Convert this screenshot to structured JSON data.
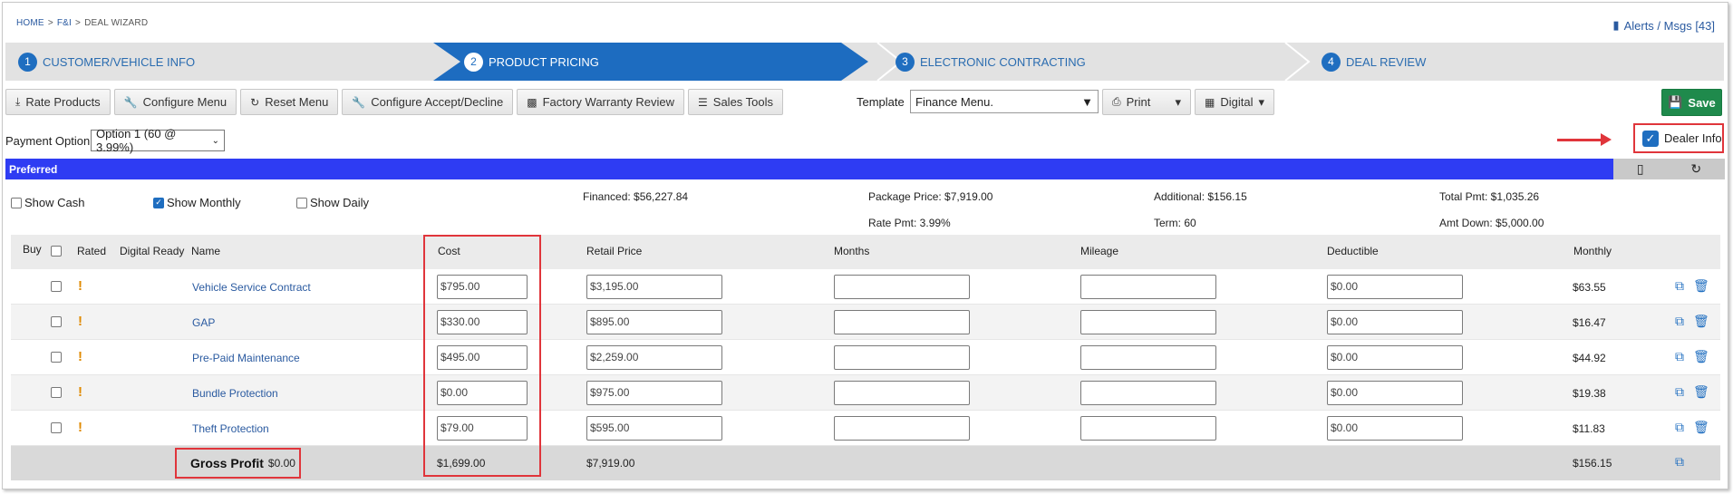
{
  "breadcrumb": {
    "home": "HOME",
    "fi": "F&I",
    "current": "DEAL WIZARD",
    "sep": ">"
  },
  "alerts": {
    "label": "Alerts / Msgs [43]"
  },
  "wizard": {
    "steps": [
      {
        "num": "1",
        "label": "CUSTOMER/VEHICLE INFO"
      },
      {
        "num": "2",
        "label": "PRODUCT PRICING"
      },
      {
        "num": "3",
        "label": "ELECTRONIC CONTRACTING"
      },
      {
        "num": "4",
        "label": "DEAL REVIEW"
      }
    ]
  },
  "toolbar": {
    "rate_products": "Rate Products",
    "configure_menu": "Configure Menu",
    "reset_menu": "Reset Menu",
    "configure_accept": "Configure Accept/Decline",
    "factory_warranty": "Factory Warranty Review",
    "sales_tools": "Sales Tools",
    "template_label": "Template",
    "template_value": "Finance Menu.",
    "print": "Print",
    "digital": "Digital",
    "save": "Save"
  },
  "payment": {
    "label": "Payment Option",
    "value": "Option 1 (60 @ 3.99%)"
  },
  "dealer_info": {
    "label": "Dealer Info",
    "checked": true
  },
  "preferred": {
    "label": "Preferred"
  },
  "show": {
    "cash": "Show Cash",
    "monthly": "Show Monthly",
    "daily": "Show Daily"
  },
  "summary": {
    "financed": "Financed: $56,227.84",
    "package_price": "Package Price: $7,919.00",
    "additional": "Additional: $156.15",
    "total_pmt": "Total Pmt: $1,035.26",
    "rate_pmt": "Rate Pmt: 3.99%",
    "term": "Term: 60",
    "amt_down": "Amt Down: $5,000.00"
  },
  "columns": {
    "buy": "Buy",
    "rated": "Rated",
    "digital_ready": "Digital Ready",
    "name": "Name",
    "cost": "Cost",
    "retail": "Retail Price",
    "months": "Months",
    "mileage": "Mileage",
    "deductible": "Deductible",
    "monthly": "Monthly"
  },
  "rows": [
    {
      "name": "Vehicle Service Contract",
      "cost": "$795.00",
      "retail": "$3,195.00",
      "months": "",
      "mileage": "",
      "deductible": "$0.00",
      "monthly": "$63.55"
    },
    {
      "name": "GAP",
      "cost": "$330.00",
      "retail": "$895.00",
      "months": "",
      "mileage": "",
      "deductible": "$0.00",
      "monthly": "$16.47"
    },
    {
      "name": "Pre-Paid Maintenance",
      "cost": "$495.00",
      "retail": "$2,259.00",
      "months": "",
      "mileage": "",
      "deductible": "$0.00",
      "monthly": "$44.92"
    },
    {
      "name": "Bundle Protection",
      "cost": "$0.00",
      "retail": "$975.00",
      "months": "",
      "mileage": "",
      "deductible": "$0.00",
      "monthly": "$19.38"
    },
    {
      "name": "Theft Protection",
      "cost": "$79.00",
      "retail": "$595.00",
      "months": "",
      "mileage": "",
      "deductible": "$0.00",
      "monthly": "$11.83"
    }
  ],
  "totals": {
    "gross_label": "Gross Profit",
    "gross_value": "$0.00",
    "cost": "$1,699.00",
    "retail": "$7,919.00",
    "monthly": "$156.15"
  },
  "colors": {
    "accent": "#1f6ec0",
    "preferred_bar": "#2e3cf3",
    "highlight": "#e0353b",
    "save": "#1f8a4c",
    "warning": "#e08a00"
  },
  "icons": [
    "download-icon",
    "wrench-icon",
    "refresh-icon",
    "chart-icon",
    "list-icon",
    "print-icon",
    "grid-icon",
    "save-icon",
    "mobile-icon",
    "copy-icon",
    "trash-icon",
    "book-icon"
  ]
}
